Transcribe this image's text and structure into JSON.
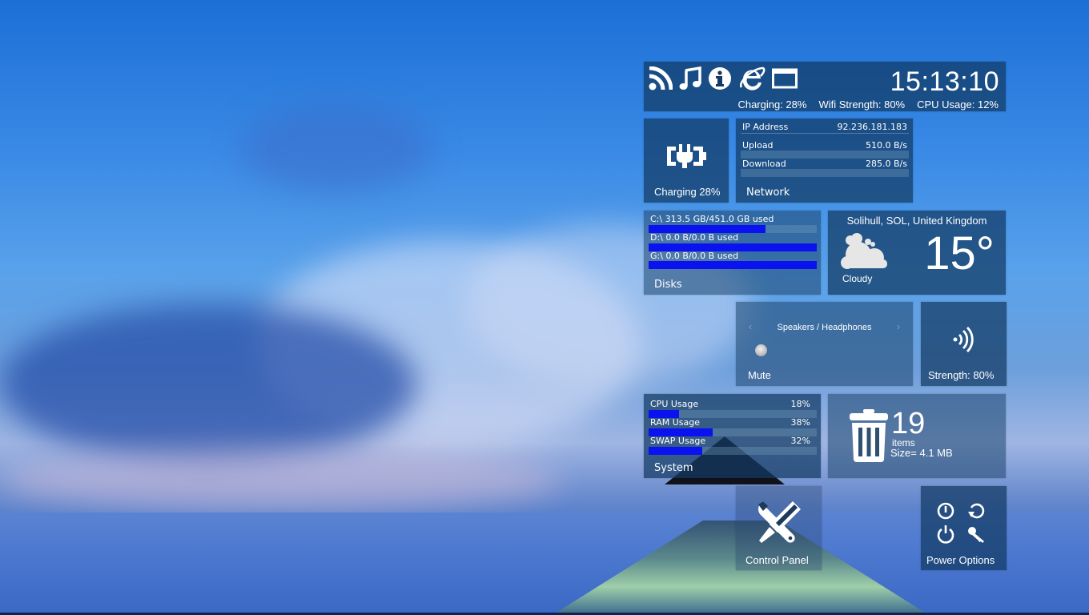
{
  "desktop": {
    "wallpaper": "ocean-pier-clouds"
  },
  "topbar": {
    "icons": [
      "rss-icon",
      "music-icon",
      "info-icon",
      "internet-explorer-icon",
      "window-icon"
    ],
    "clock": "15:13:10",
    "status": {
      "charging": "Charging: 28%",
      "wifi": "Wifi Strength: 80%",
      "cpu": "CPU Usage: 12%"
    }
  },
  "battery": {
    "label": "Charging 28%",
    "percent": 28
  },
  "network": {
    "title": "Network",
    "rows": [
      {
        "label": "IP Address",
        "value": "92.236.181.183"
      },
      {
        "label": "Upload",
        "value": "510.0 B/s"
      },
      {
        "label": "Download",
        "value": "285.0 B/s"
      }
    ]
  },
  "disks": {
    "title": "Disks",
    "items": [
      {
        "label": "C:\\  313.5 GB/451.0 GB used",
        "fill_fraction": 0.695
      },
      {
        "label": "D:\\  0.0 B/0.0 B used",
        "fill_fraction": 1.0
      },
      {
        "label": "G:\\  0.0 B/0.0 B used",
        "fill_fraction": 1.0
      }
    ],
    "bar_color": "#0a12f0"
  },
  "weather": {
    "location": "Solihull, SOL, United Kingdom",
    "temperature": "15°",
    "condition": "Cloudy"
  },
  "audio": {
    "device": "Speakers / Headphones",
    "prev_arrow": "‹",
    "next_arrow": "›",
    "label": "Mute"
  },
  "wifi": {
    "label": "Strength: 80%",
    "percent": 80
  },
  "system": {
    "title": "System",
    "items": [
      {
        "label": "CPU Usage",
        "value": "18%",
        "fill_fraction": 0.18
      },
      {
        "label": "RAM Usage",
        "value": "38%",
        "fill_fraction": 0.38
      },
      {
        "label": "SWAP Usage",
        "value": "32%",
        "fill_fraction": 0.32
      }
    ]
  },
  "recycle_bin": {
    "count": "19",
    "items_label": "items",
    "size": "Size= 4.1 MB"
  },
  "control_panel": {
    "label": "Control Panel"
  },
  "power": {
    "label": "Power Options",
    "buttons": [
      "shutdown-icon",
      "restart-icon",
      "power-icon",
      "lock-key-icon"
    ]
  }
}
